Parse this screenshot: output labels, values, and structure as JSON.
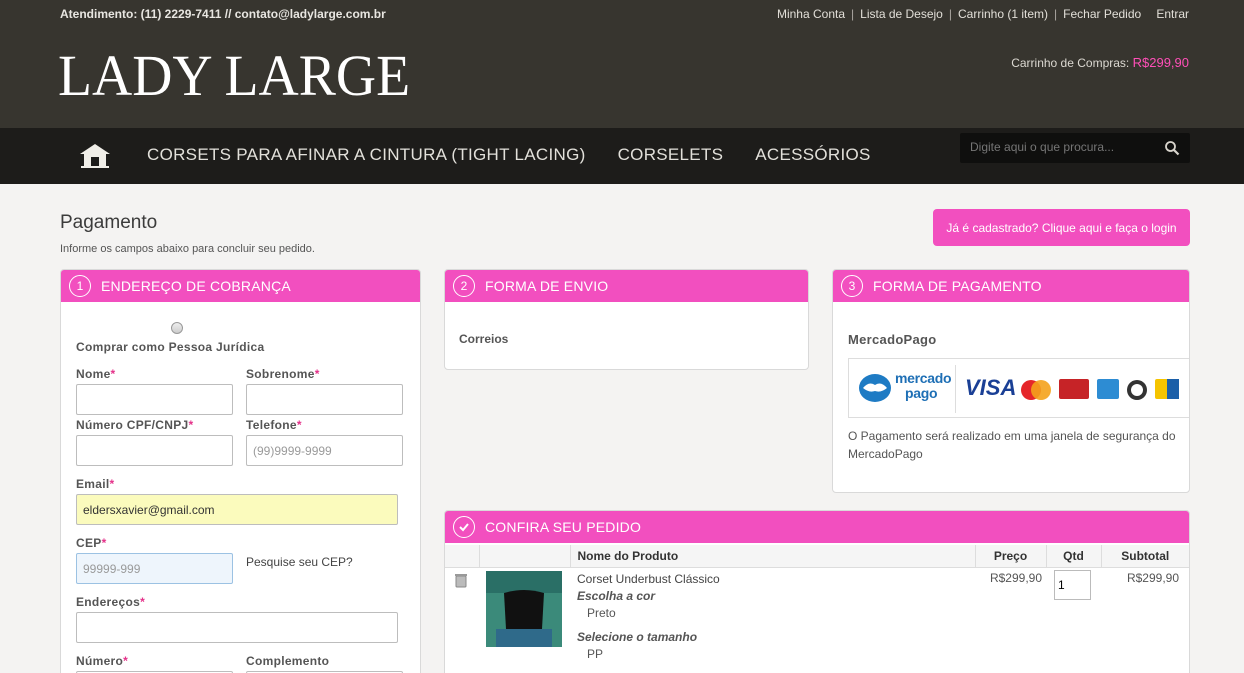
{
  "header": {
    "contact": "Atendimento: (11) 2229-7411 // contato@ladylarge.com.br",
    "links": [
      "Minha Conta",
      "Lista de Desejo",
      "Carrinho (1 item)",
      "Fechar Pedido",
      "Entrar"
    ],
    "logo": "LADY LARGE",
    "cart_label": "Carrinho de Compras:",
    "cart_total": "R$299,90"
  },
  "nav": {
    "items": [
      "CORSETS PARA AFINAR A CINTURA (TIGHT LACING)",
      "CORSELETS",
      "ACESSÓRIOS"
    ],
    "search_placeholder": "Digite aqui o que procura..."
  },
  "page": {
    "title": "Pagamento",
    "subtitle": "Informe os campos abaixo para concluir seu pedido.",
    "login_button": "Já é cadastrado? Clique aqui e faça o login"
  },
  "billing": {
    "step": "1",
    "title": "ENDEREÇO DE COBRANÇA",
    "pj_label": "Comprar como Pessoa Jurídica",
    "nome_label": "Nome",
    "sobrenome_label": "Sobrenome",
    "cpf_label": "Número CPF/CNPJ",
    "telefone_label": "Telefone",
    "telefone_placeholder": "(99)9999-9999",
    "email_label": "Email",
    "email_value": "eldersxavier@gmail.com",
    "cep_label": "CEP",
    "cep_placeholder": "99999-999",
    "cep_link": "Pesquise seu CEP?",
    "endereco_label": "Endereços",
    "numero_label": "Número",
    "complemento_label": "Complemento",
    "required_mark": "*"
  },
  "shipping": {
    "step": "2",
    "title": "FORMA DE ENVIO",
    "method": "Correios"
  },
  "payment": {
    "step": "3",
    "title": "FORMA DE PAGAMENTO",
    "method": "MercadoPago",
    "mp_logo_line1": "mercado",
    "mp_logo_line2": "pago",
    "visa_text": "VISA",
    "description": "O Pagamento será realizado em uma janela de segurança do MercadoPago"
  },
  "review": {
    "title": "CONFIRA SEU PEDIDO",
    "columns": [
      "Nome do Produto",
      "Preço",
      "Qtd",
      "Subtotal"
    ],
    "item": {
      "name": "Corset Underbust Clássico",
      "option1_label": "Escolha a cor",
      "option1_value": "Preto",
      "option2_label": "Selecione o tamanho",
      "option2_value": "PP",
      "price": "R$299,90",
      "qty": "1",
      "subtotal": "R$299,90"
    }
  },
  "colors": {
    "accent": "#f24fbf",
    "header_bg": "#37352f",
    "nav_bg": "#1d1c1a"
  }
}
